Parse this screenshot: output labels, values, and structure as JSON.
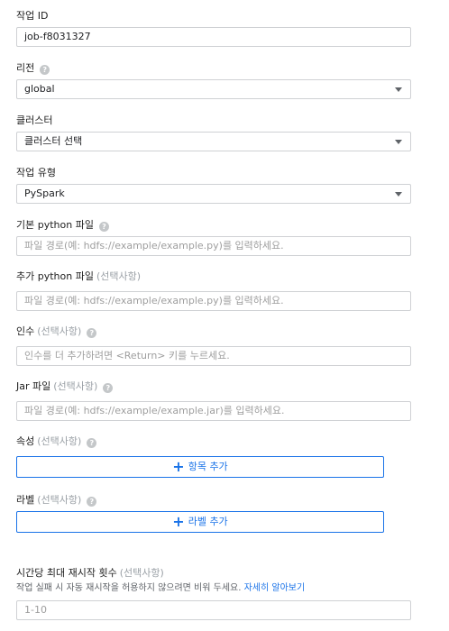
{
  "job_id": {
    "label": "작업 ID",
    "value": "job-f8031327"
  },
  "region": {
    "label": "리전",
    "value": "global",
    "help_icon": "help-icon"
  },
  "cluster": {
    "label": "클러스터",
    "value": "클러스터 선택"
  },
  "job_type": {
    "label": "작업 유형",
    "value": "PySpark"
  },
  "main_python": {
    "label": "기본 python 파일",
    "placeholder": "파일 경로(예: hdfs://example/example.py)를 입력하세요."
  },
  "extra_python": {
    "label": "추가 python 파일",
    "optional": "(선택사항)",
    "placeholder": "파일 경로(예: hdfs://example/example.py)를 입력하세요."
  },
  "arguments": {
    "label": "인수",
    "optional": "(선택사항)",
    "placeholder": "인수를 더 추가하려면 <Return> 키를 누르세요."
  },
  "jar": {
    "label": "Jar 파일",
    "optional": "(선택사항)",
    "placeholder": "파일 경로(예: hdfs://example/example.jar)를 입력하세요."
  },
  "properties": {
    "label": "속성",
    "optional": "(선택사항)",
    "button": "항목 추가"
  },
  "labels": {
    "label": "라벨",
    "optional": "(선택사항)",
    "button": "라벨 추가"
  },
  "restarts": {
    "label": "시간당 최대 재시작 횟수",
    "optional": "(선택사항)",
    "hint": "작업 실패 시 자동 재시작을 허용하지 않으려면 비워 두세요.",
    "link": "자세히 알아보기",
    "placeholder": "1-10"
  },
  "colors": {
    "accent": "#1a73e8",
    "border": "#cfd1d4",
    "help": "#c4c7c9"
  }
}
